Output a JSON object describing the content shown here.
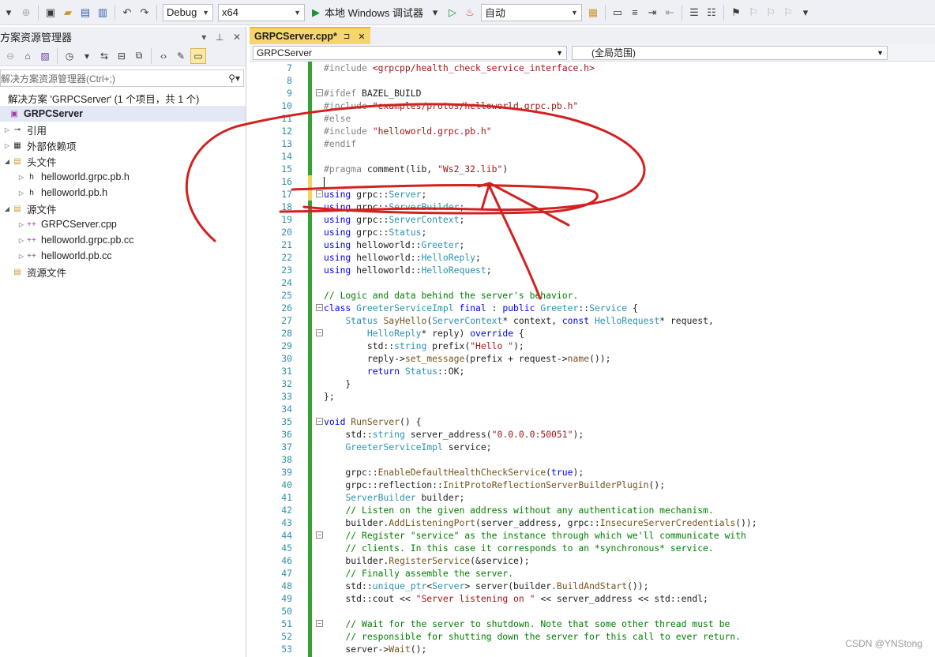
{
  "toolbar": {
    "config": "Debug",
    "platform": "x64",
    "run_label": "本地 Windows 调试器",
    "auto": "自动"
  },
  "solution_explorer": {
    "title": "方案资源管理器",
    "search_placeholder": "解决方案资源管理器(Ctrl+;)",
    "tree": [
      {
        "label": "解决方案 'GRPCServer' (1 个项目，共 1 个)",
        "icon": "solution-icon",
        "depth": 0,
        "exp": ""
      },
      {
        "label": "GRPCServer",
        "icon": "project-icon",
        "depth": 0,
        "exp": "",
        "bold": true
      },
      {
        "label": "引用",
        "icon": "references-icon",
        "depth": 1,
        "exp": "▷"
      },
      {
        "label": "外部依赖项",
        "icon": "external-deps-icon",
        "depth": 1,
        "exp": "▷"
      },
      {
        "label": "头文件",
        "icon": "folder-icon",
        "depth": 1,
        "exp": "◢"
      },
      {
        "label": "helloworld.grpc.pb.h",
        "icon": "header-file-icon",
        "depth": 2,
        "exp": "▷"
      },
      {
        "label": "helloworld.pb.h",
        "icon": "header-file-icon",
        "depth": 2,
        "exp": "▷"
      },
      {
        "label": "源文件",
        "icon": "folder-icon",
        "depth": 1,
        "exp": "◢"
      },
      {
        "label": "GRPCServer.cpp",
        "icon": "cpp-file-icon",
        "depth": 2,
        "exp": "▷"
      },
      {
        "label": "helloworld.grpc.pb.cc",
        "icon": "cpp-file-icon",
        "depth": 2,
        "exp": "▷"
      },
      {
        "label": "helloworld.pb.cc",
        "icon": "cpp-file-icon",
        "depth": 2,
        "exp": "▷"
      },
      {
        "label": "资源文件",
        "icon": "folder-icon",
        "depth": 1,
        "exp": ""
      }
    ]
  },
  "editor": {
    "tab_label": "GRPCServer.cpp*",
    "scope_left": "GRPCServer",
    "scope_right": "(全局范围)",
    "lines": [
      {
        "n": "7",
        "html": "<span class=\"pp\">#include</span> <span class=\"st\">&lt;grpcpp/health_check_service_interface.h&gt;</span>"
      },
      {
        "n": "8",
        "html": ""
      },
      {
        "n": "9",
        "html": "<span class=\"pp\">#ifdef</span> BAZEL_BUILD"
      },
      {
        "n": "10",
        "html": "<span class=\"pp\">#include</span> <span class=\"st\">\"examples/protos/helloworld.grpc.pb.h\"</span>"
      },
      {
        "n": "11",
        "html": "<span class=\"pp\">#else</span>"
      },
      {
        "n": "12",
        "html": "<span class=\"pp\">#include</span> <span class=\"st\">\"helloworld.grpc.pb.h\"</span>"
      },
      {
        "n": "13",
        "html": "<span class=\"pp\">#endif</span>"
      },
      {
        "n": "14",
        "html": ""
      },
      {
        "n": "15",
        "html": "<span class=\"pp\">#pragma</span> comment(lib, <span class=\"st\">\"Ws2_32.lib\"</span>)"
      },
      {
        "n": "16",
        "html": ""
      },
      {
        "n": "17",
        "html": "<span class=\"kw\">using</span> grpc::<span class=\"ty\">Server</span>;"
      },
      {
        "n": "18",
        "html": "<span class=\"kw\">using</span> grpc::<span class=\"ty\">ServerBuilder</span>;"
      },
      {
        "n": "19",
        "html": "<span class=\"kw\">using</span> grpc::<span class=\"ty\">ServerContext</span>;"
      },
      {
        "n": "20",
        "html": "<span class=\"kw\">using</span> grpc::<span class=\"ty\">Status</span>;"
      },
      {
        "n": "21",
        "html": "<span class=\"kw\">using</span> helloworld::<span class=\"ty\">Greeter</span>;"
      },
      {
        "n": "22",
        "html": "<span class=\"kw\">using</span> helloworld::<span class=\"ty\">HelloReply</span>;"
      },
      {
        "n": "23",
        "html": "<span class=\"kw\">using</span> helloworld::<span class=\"ty\">HelloRequest</span>;"
      },
      {
        "n": "24",
        "html": ""
      },
      {
        "n": "25",
        "html": "<span class=\"cm\">// Logic and data behind the server's behavior.</span>"
      },
      {
        "n": "26",
        "html": "<span class=\"kw\">class</span> <span class=\"ty\">GreeterServiceImpl</span> <span class=\"kw\">final</span> : <span class=\"kw\">public</span> <span class=\"ty\">Greeter</span>::<span class=\"ty\">Service</span> {"
      },
      {
        "n": "27",
        "html": "    <span class=\"ty\">Status</span> <span class=\"fn\">SayHello</span>(<span class=\"ty\">ServerContext</span>* context, <span class=\"kw\">const</span> <span class=\"ty\">HelloRequest</span>* request,"
      },
      {
        "n": "28",
        "html": "        <span class=\"ty\">HelloReply</span>* reply) <span class=\"kw\">override</span> {"
      },
      {
        "n": "29",
        "html": "        std::<span class=\"ty\">string</span> prefix(<span class=\"st\">\"Hello \"</span>);"
      },
      {
        "n": "30",
        "html": "        reply-&gt;<span class=\"fn\">set_message</span>(prefix + request-&gt;<span class=\"fn\">name</span>());"
      },
      {
        "n": "31",
        "html": "        <span class=\"kw\">return</span> <span class=\"ty\">Status</span>::OK;"
      },
      {
        "n": "32",
        "html": "    }"
      },
      {
        "n": "33",
        "html": "};"
      },
      {
        "n": "34",
        "html": ""
      },
      {
        "n": "35",
        "html": "<span class=\"kw\">void</span> <span class=\"fn\">RunServer</span>() {"
      },
      {
        "n": "36",
        "html": "    std::<span class=\"ty\">string</span> server_address(<span class=\"st\">\"0.0.0.0:50051\"</span>);"
      },
      {
        "n": "37",
        "html": "    <span class=\"ty\">GreeterServiceImpl</span> service;"
      },
      {
        "n": "38",
        "html": ""
      },
      {
        "n": "39",
        "html": "    grpc::<span class=\"fn\">EnableDefaultHealthCheckService</span>(<span class=\"kw\">true</span>);"
      },
      {
        "n": "40",
        "html": "    grpc::reflection::<span class=\"fn\">InitProtoReflectionServerBuilderPlugin</span>();"
      },
      {
        "n": "41",
        "html": "    <span class=\"ty\">ServerBuilder</span> builder;"
      },
      {
        "n": "42",
        "html": "    <span class=\"cm\">// Listen on the given address without any authentication mechanism.</span>"
      },
      {
        "n": "43",
        "html": "    builder.<span class=\"fn\">AddListeningPort</span>(server_address, grpc::<span class=\"fn\">InsecureServerCredentials</span>());"
      },
      {
        "n": "44",
        "html": "    <span class=\"cm\">// Register \"service\" as the instance through which we'll communicate with</span>"
      },
      {
        "n": "45",
        "html": "    <span class=\"cm\">// clients. In this case it corresponds to an *synchronous* service.</span>"
      },
      {
        "n": "46",
        "html": "    builder.<span class=\"fn\">RegisterService</span>(&amp;service);"
      },
      {
        "n": "47",
        "html": "    <span class=\"cm\">// Finally assemble the server.</span>"
      },
      {
        "n": "48",
        "html": "    std::<span class=\"ty\">unique_ptr</span>&lt;<span class=\"ty\">Server</span>&gt; server(builder.<span class=\"fn\">BuildAndStart</span>());"
      },
      {
        "n": "49",
        "html": "    std::cout &lt;&lt; <span class=\"st\">\"Server listening on \"</span> &lt;&lt; server_address &lt;&lt; std::endl;"
      },
      {
        "n": "50",
        "html": ""
      },
      {
        "n": "51",
        "html": "    <span class=\"cm\">// Wait for the server to shutdown. Note that some other thread must be</span>"
      },
      {
        "n": "52",
        "html": "    <span class=\"cm\">// responsible for shutting down the server for this call to ever return.</span>"
      },
      {
        "n": "53",
        "html": "    server-&gt;<span class=\"fn\">Wait</span>();"
      }
    ]
  },
  "watermark": "CSDN @YNStong"
}
